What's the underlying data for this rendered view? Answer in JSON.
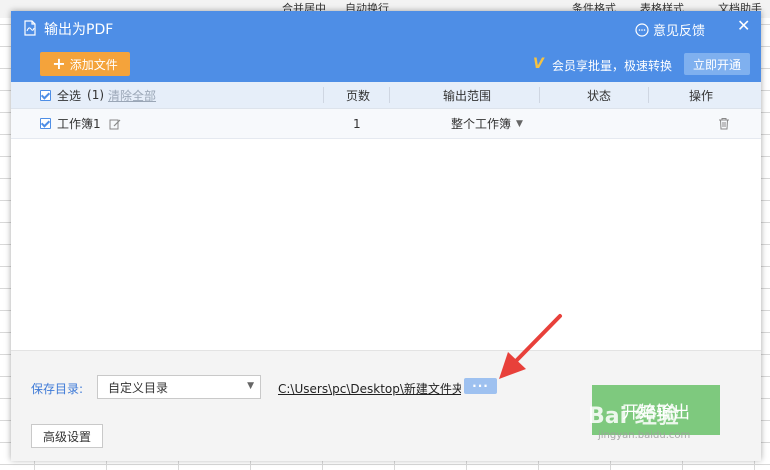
{
  "background": {
    "toolbar_items": [
      "合并居中",
      "自动换行",
      "条件格式",
      "表格样式",
      "文档助手"
    ]
  },
  "dialog": {
    "title": "输出为PDF",
    "feedback_label": "意见反馈",
    "close_label": "✕",
    "add_file_label": "添加文件",
    "promo_text": "会员享批量，极速转换",
    "open_vip_label": "立即开通",
    "table": {
      "select_all_label": "全选",
      "count_label": "(1)",
      "clear_all_label": "清除全部",
      "columns": [
        "页数",
        "输出范围",
        "状态",
        "操作"
      ],
      "rows": [
        {
          "name": "工作簿1",
          "pages": "1",
          "range": "整个工作簿",
          "status": ""
        }
      ]
    },
    "footer": {
      "save_dir_label": "保存目录:",
      "dir_option": "自定义目录",
      "path": "C:\\Users\\pc\\Desktop\\新建文件夹",
      "browse_label": "···",
      "start_label": "开始输出",
      "advanced_label": "高级设置"
    },
    "watermark": {
      "brand": "Bai 经验",
      "url": "jingyan.baidu.com"
    },
    "colors": {
      "header_blue": "#4e8ee6",
      "add_button": "#f4a33b",
      "start_button": "#7ec97e",
      "annotation_arrow": "#e8403a"
    }
  }
}
